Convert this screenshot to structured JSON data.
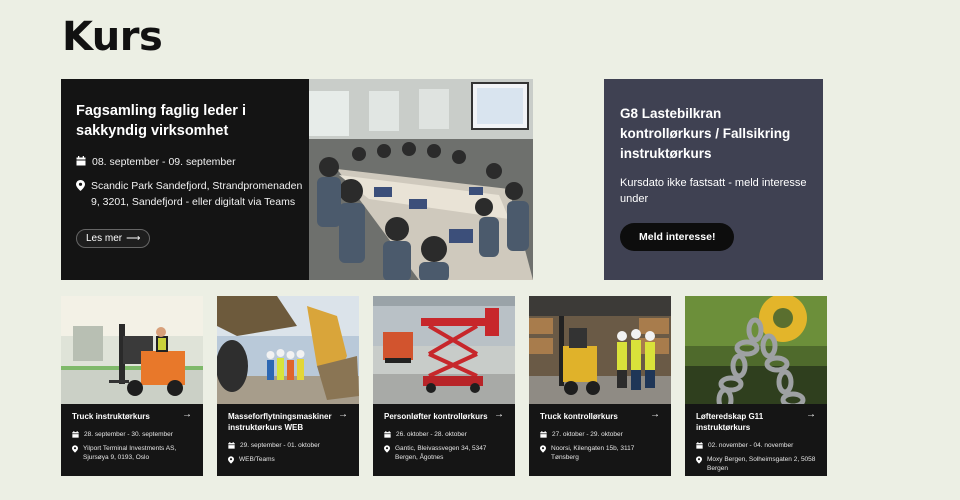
{
  "page": {
    "title": "Kurs"
  },
  "featured": {
    "title": "Fagsamling faglig leder i sakkyndig virksomhet",
    "date": "08. september - 09. september",
    "location": "Scandic Park Sandefjord, Strandpromenaden 9, 3201, Sandefjord - eller digitalt via Teams",
    "button": "Les mer",
    "arrow": "⟶",
    "photo_icon": "conference-photo"
  },
  "promo": {
    "title": "G8 Lastebilkran kontrollørkurs / Fallsikring instruktørkurs",
    "text": "Kursdato ikke fastsatt - meld interesse under",
    "button": "Meld interesse!"
  },
  "cards": [
    {
      "title": "Truck instruktørkurs",
      "date": "28. september - 30. september",
      "location": "Yilport Terminal Investments AS, Sjursøya 9, 0193, Oslo",
      "arrow": "→"
    },
    {
      "title": "Masseforflytningsmaskiner instruktørkurs WEB",
      "date": "29. september - 01. oktober",
      "location": "WEB/Teams",
      "arrow": "→"
    },
    {
      "title": "Personløfter kontrollørkurs",
      "date": "26. oktober - 28. oktober",
      "location": "Gantic, Bleivassvegen 34, 5347 Bergen, Ågotnes",
      "arrow": "→"
    },
    {
      "title": "Truck kontrollørkurs",
      "date": "27. oktober - 29. oktober",
      "location": "Noorsi, Kilengaten 15b, 3117 Tønsberg",
      "arrow": "→"
    },
    {
      "title": "Løfteredskap G11 instruktørkurs",
      "date": "02. november - 04. november",
      "location": "Moxy Bergen, Solheimsgaten 2, 5058 Bergen",
      "arrow": "→"
    }
  ],
  "colors": {
    "background": "#ecefe4",
    "featured_bg": "#141414",
    "promo_bg": "#3f4152",
    "card_bg": "#151515",
    "accent_orange": "#e8782a"
  },
  "icons": {
    "date": "calendar-icon",
    "location": "location-pin-icon",
    "arrow": "arrow-right-icon"
  }
}
